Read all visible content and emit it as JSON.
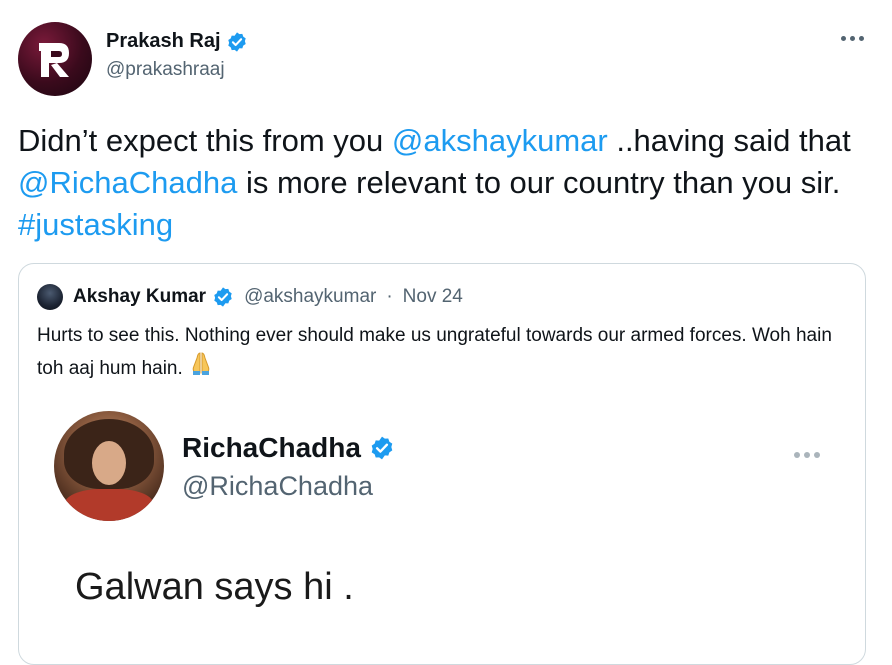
{
  "tweet": {
    "author": {
      "name": "Prakash Raj",
      "handle": "@prakashraaj",
      "avatar_icon": "pr-monogram-logo"
    },
    "text_parts": {
      "p1": "Didn’t expect this from you ",
      "m1": "@akshaykumar",
      "p2": " ..having said that ",
      "m2": "@RichaChadha",
      "p3": " is more relevant to our country than you sir. ",
      "h1": "#justasking"
    },
    "more_icon": "more-horizontal-icon"
  },
  "quote": {
    "name": "Akshay Kumar",
    "handle": "@akshaykumar",
    "separator": "·",
    "date": "Nov 24",
    "text": "Hurts to see this. Nothing ever should make us ungrateful towards our armed forces. Woh hain toh aaj hum hain.",
    "emoji_icon": "folded-hands-icon",
    "embedded": {
      "name": "RichaChadha",
      "handle": "@RichaChadha",
      "text": "Galwan says hi ."
    }
  },
  "colors": {
    "link": "#1d9bf0",
    "verified": "#1d9bf0",
    "secondary_text": "#536471",
    "border": "#cfd9de"
  }
}
